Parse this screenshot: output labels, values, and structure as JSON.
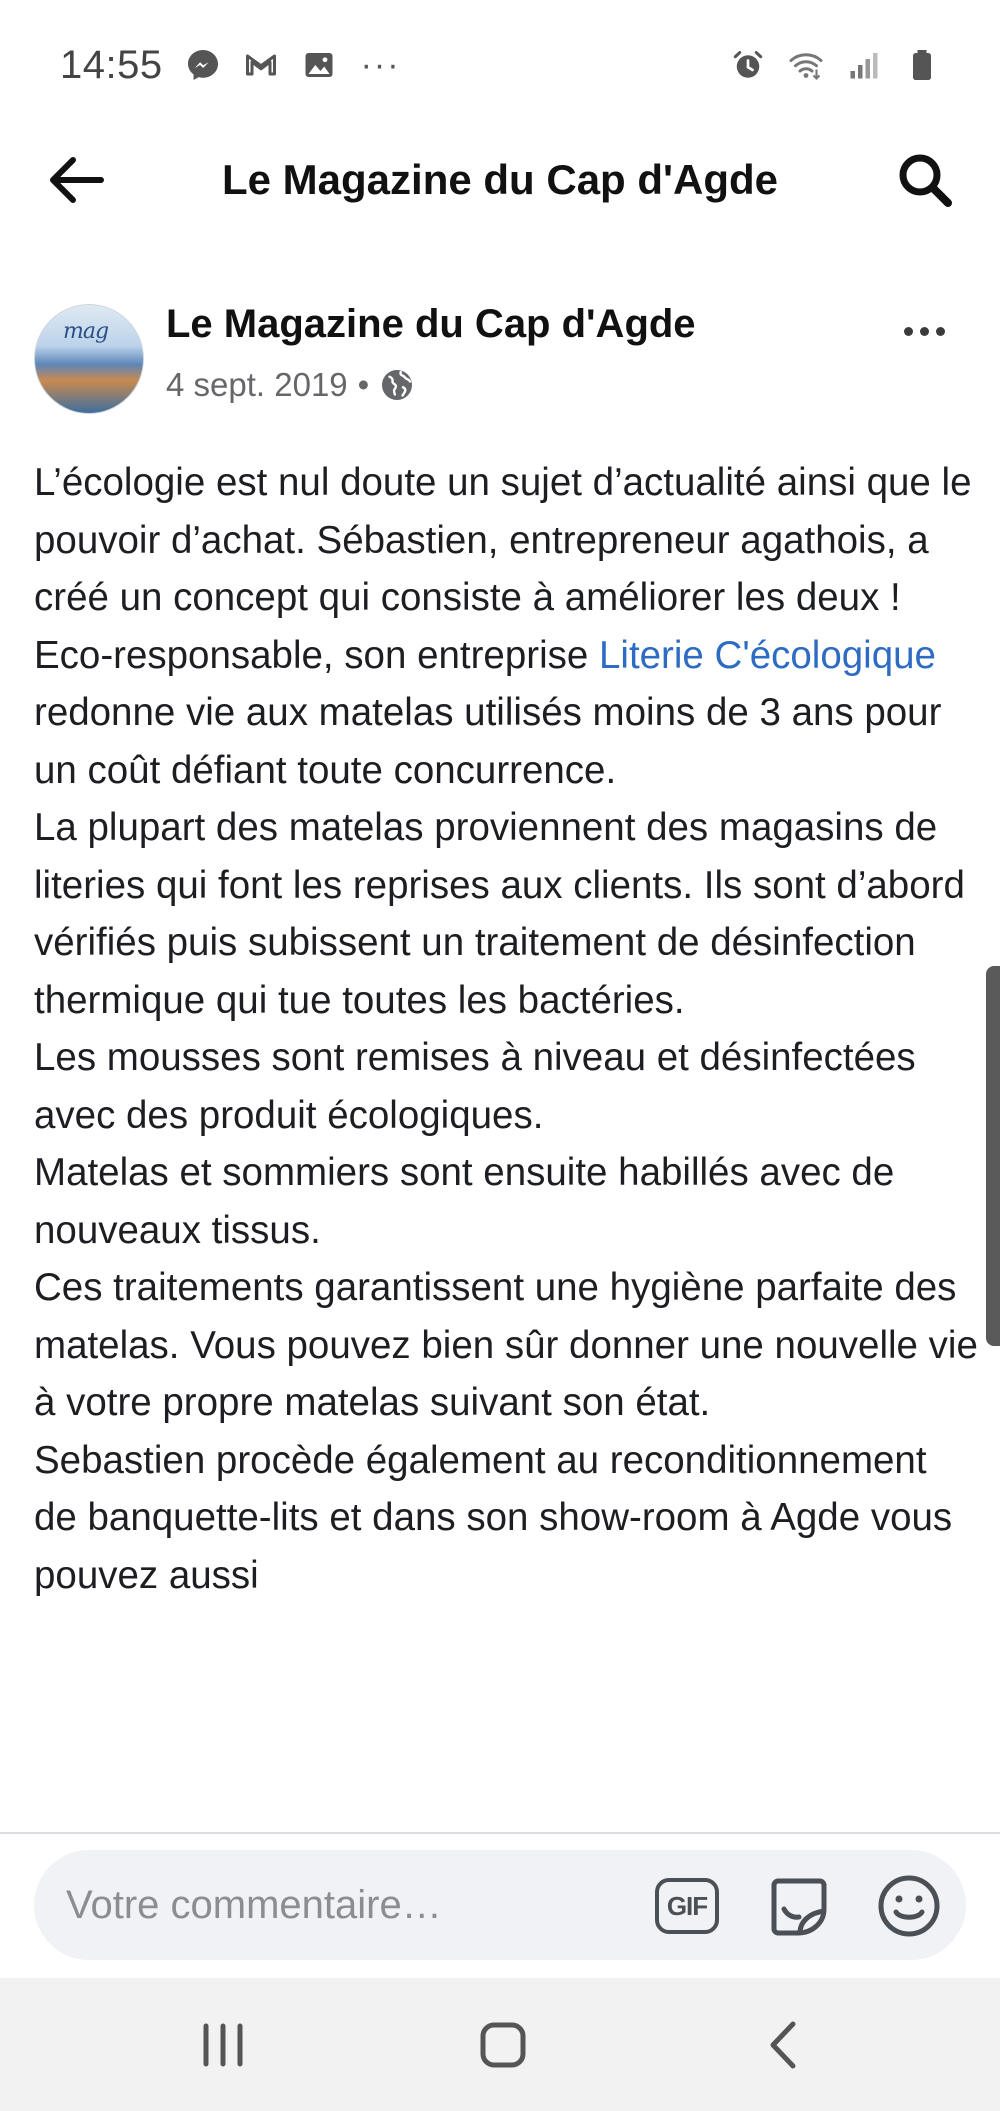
{
  "status_bar": {
    "time": "14:55",
    "left_icons": [
      "messenger-icon",
      "gmail-icon",
      "gallery-icon"
    ],
    "more": "···",
    "right_icons": [
      "alarm-icon",
      "wifi-icon",
      "signal-icon",
      "battery-icon"
    ]
  },
  "header": {
    "title": "Le Magazine du Cap d'Agde",
    "back_icon": "arrow-left-icon",
    "search_icon": "search-icon"
  },
  "post": {
    "author": "Le Magazine du Cap d'Agde",
    "avatar_text": "mag",
    "date": "4 sept. 2019",
    "separator": "•",
    "privacy_icon": "globe-icon",
    "more_icon": "more-horizontal-icon",
    "paragraphs": {
      "p1": "L’écologie est nul doute un sujet d’actualité ainsi que le pouvoir d’achat. Sébastien, entrepreneur agathois, a créé un concept qui consiste à améliorer les deux !",
      "p2_before": "Eco-responsable, son entreprise ",
      "p2_link": "Literie C'écologique",
      "p2_after": " redonne vie aux matelas utilisés moins de 3 ans pour un coût défiant toute concurrence.",
      "p3": "La plupart des matelas proviennent des magasins de literies qui font les reprises aux clients. Ils sont d’abord vérifiés puis subissent un traitement de désinfection thermique qui tue toutes les bactéries.",
      "p4": "Les mousses sont remises à niveau et désinfectées avec des produit écologiques.",
      "p5": "Matelas et sommiers sont ensuite habillés avec de nouveaux tissus.",
      "p6": "Ces traitements garantissent une hygiène parfaite des matelas. Vous pouvez bien sûr donner une nouvelle vie à votre propre matelas suivant son état.",
      "p7": "Sebastien procède également au reconditionnement de banquette-lits et dans son show-room à Agde vous pouvez aussi"
    }
  },
  "composer": {
    "placeholder": "Votre commentaire…",
    "gif_label": "GIF"
  },
  "nav": {
    "recents_icon": "recents-icon",
    "home_icon": "home-icon",
    "back_icon": "back-icon"
  },
  "colors": {
    "link": "#2d6cc2",
    "text": "#1c1e21",
    "meta": "#65676b",
    "composer_bg": "#f0f2f5",
    "nav_bg": "#f2f2f2"
  }
}
